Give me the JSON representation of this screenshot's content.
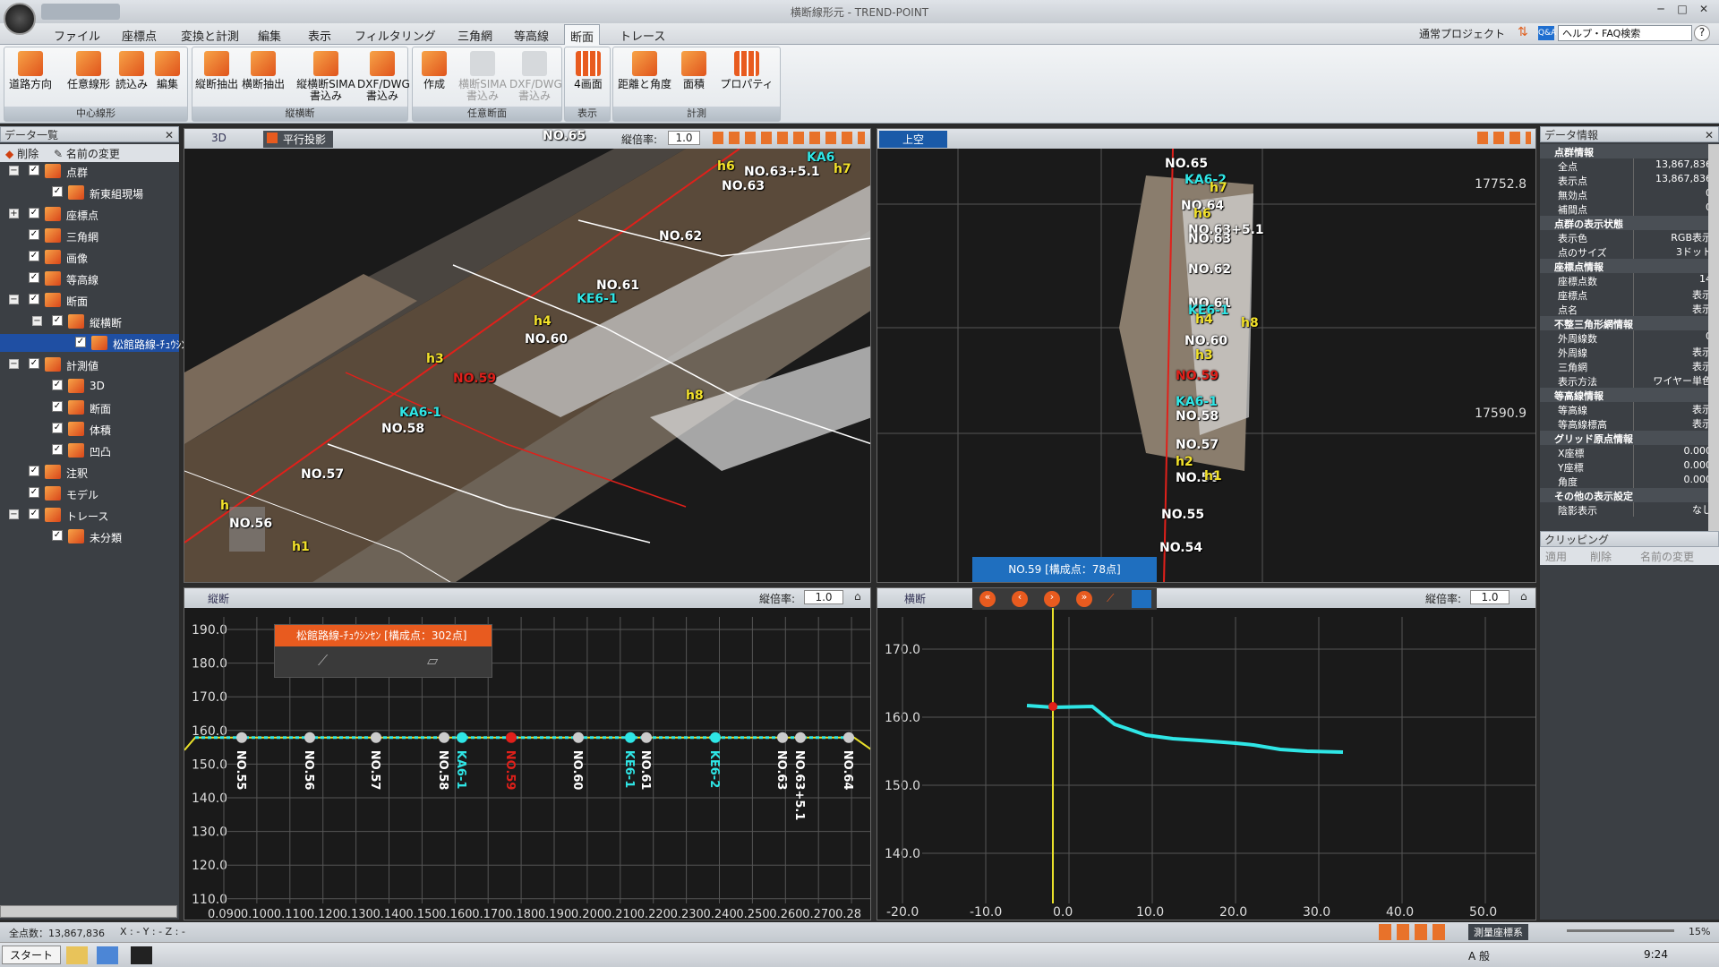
{
  "titlebar": {
    "title": "横断線形元 - TREND-POINT"
  },
  "tabs": [
    "ファイル",
    "座標点",
    "変換と計測",
    "編集",
    "表示",
    "フィルタリング",
    "三角網",
    "等高線",
    "断面",
    "トレース"
  ],
  "active_tab": "断面",
  "topright": {
    "project": "通常プロジェクト",
    "search_placeholder": "ヘルプ・FAQ検索"
  },
  "ribbon": {
    "groups": [
      {
        "label": "中心線形",
        "buttons": [
          "道路方向",
          "任意線形",
          "読込み",
          "編集"
        ]
      },
      {
        "label": "縦横断",
        "buttons": [
          "縦断抽出",
          "横断抽出",
          "縦横断SIMA 書込み",
          "DXF/DWG 書込み"
        ]
      },
      {
        "label": "任意断面",
        "buttons": [
          "作成",
          "横断SIMA 書込み",
          "DXF/DWG 書込み"
        ]
      },
      {
        "label": "表示",
        "buttons": [
          "4画面"
        ]
      },
      {
        "label": "計測",
        "buttons": [
          "距離と角度",
          "面積",
          "プロパティ"
        ]
      }
    ]
  },
  "left_panel": {
    "title": "データ一覧",
    "toolbar": {
      "delete": "削除",
      "rename": "名前の変更"
    },
    "tree": [
      {
        "label": "点群",
        "level": 0,
        "expand": "−"
      },
      {
        "label": "新東組現場",
        "level": 1
      },
      {
        "label": "座標点",
        "level": 0,
        "expand": "+"
      },
      {
        "label": "三角網",
        "level": 0
      },
      {
        "label": "画像",
        "level": 0
      },
      {
        "label": "等高線",
        "level": 0
      },
      {
        "label": "断面",
        "level": 0,
        "expand": "−"
      },
      {
        "label": "縦横断",
        "level": 1,
        "expand": "−"
      },
      {
        "label": "松館路線-ﾁｭｳｼﾝｾﾝ",
        "level": 2,
        "selected": true
      },
      {
        "label": "計測値",
        "level": 0,
        "expand": "−"
      },
      {
        "label": "3D",
        "level": 1
      },
      {
        "label": "断面",
        "level": 1
      },
      {
        "label": "体積",
        "level": 1
      },
      {
        "label": "凹凸",
        "level": 1
      },
      {
        "label": "注釈",
        "level": 0
      },
      {
        "label": "モデル",
        "level": 0
      },
      {
        "label": "トレース",
        "level": 0,
        "expand": "−"
      },
      {
        "label": "未分類",
        "level": 1
      }
    ]
  },
  "view3d": {
    "tab": "3D",
    "mode": "平行投影",
    "scale_label": "縦倍率:",
    "scale": "1.0",
    "labels": [
      {
        "t": "NO.65",
        "c": "w"
      },
      {
        "t": "h6",
        "c": "y"
      },
      {
        "t": "NO.63+5.1",
        "c": "w"
      },
      {
        "t": "KA6",
        "c": "c"
      },
      {
        "t": "h7",
        "c": "y"
      },
      {
        "t": "NO.63",
        "c": "w"
      },
      {
        "t": "NO.62",
        "c": "w"
      },
      {
        "t": "NO.61",
        "c": "w"
      },
      {
        "t": "KE6-1",
        "c": "c"
      },
      {
        "t": "h4",
        "c": "y"
      },
      {
        "t": "NO.60",
        "c": "w"
      },
      {
        "t": "h3",
        "c": "y"
      },
      {
        "t": "NO.59",
        "c": "r"
      },
      {
        "t": "h8",
        "c": "y"
      },
      {
        "t": "KA6-1",
        "c": "c"
      },
      {
        "t": "NO.58",
        "c": "w"
      },
      {
        "t": "NO.57",
        "c": "w"
      },
      {
        "t": "NO.56",
        "c": "w"
      },
      {
        "t": "h1",
        "c": "y"
      },
      {
        "t": "h",
        "c": "y"
      }
    ]
  },
  "viewTop": {
    "tab": "上空",
    "ycoord1": "17752.8",
    "ycoord2": "17590.9",
    "labels": [
      {
        "t": "NO.65",
        "c": "w"
      },
      {
        "t": "KA6-2",
        "c": "c"
      },
      {
        "t": "h7",
        "c": "y"
      },
      {
        "t": "NO.64",
        "c": "w"
      },
      {
        "t": "h6",
        "c": "y"
      },
      {
        "t": "NO.63+5.1",
        "c": "w"
      },
      {
        "t": "NO.63",
        "c": "w"
      },
      {
        "t": "NO.62",
        "c": "w"
      },
      {
        "t": "NO.61",
        "c": "w"
      },
      {
        "t": "KE6-1",
        "c": "c"
      },
      {
        "t": "h4",
        "c": "y"
      },
      {
        "t": "h8",
        "c": "y"
      },
      {
        "t": "NO.60",
        "c": "w"
      },
      {
        "t": "h3",
        "c": "y"
      },
      {
        "t": "NO.59",
        "c": "r"
      },
      {
        "t": "KA6-1",
        "c": "c"
      },
      {
        "t": "NO.58",
        "c": "w"
      },
      {
        "t": "NO.57",
        "c": "w"
      },
      {
        "t": "h2",
        "c": "y"
      },
      {
        "t": "NO.56",
        "c": "w"
      },
      {
        "t": "h1",
        "c": "y"
      },
      {
        "t": "NO.55",
        "c": "w"
      },
      {
        "t": "NO.54",
        "c": "w"
      }
    ]
  },
  "longitudinal": {
    "tab": "縦断",
    "scale_label": "縦倍率:",
    "scale": "1.0",
    "popup": "松館路線-ﾁｭｳｼﾝｾﾝ [構成点：302点]",
    "y_ticks": [
      "190.0",
      "180.0",
      "170.0",
      "160.0",
      "150.0",
      "140.0",
      "130.0",
      "120.0",
      "110.0"
    ],
    "x_ticks": [
      "0.090",
      "0.100",
      "0.110",
      "0.120",
      "0.130",
      "0.140",
      "0.150",
      "0.160",
      "0.170",
      "0.180",
      "0.190",
      "0.200",
      "0.210",
      "0.220",
      "0.230",
      "0.240",
      "0.250",
      "0.260",
      "0.270",
      "0.28"
    ],
    "stations": [
      {
        "t": "NO.55",
        "c": "w"
      },
      {
        "t": "NO.56",
        "c": "w"
      },
      {
        "t": "NO.57",
        "c": "w"
      },
      {
        "t": "NO.58",
        "c": "w"
      },
      {
        "t": "KA6-1",
        "c": "c"
      },
      {
        "t": "NO.59",
        "c": "r"
      },
      {
        "t": "NO.60",
        "c": "w"
      },
      {
        "t": "KE6-1",
        "c": "c"
      },
      {
        "t": "NO.61",
        "c": "w"
      },
      {
        "t": "KE6-2",
        "c": "c"
      },
      {
        "t": "NO.63",
        "c": "w"
      },
      {
        "t": "NO.63+5.1",
        "c": "w"
      },
      {
        "t": "NO.64",
        "c": "w"
      }
    ]
  },
  "cross": {
    "tab": "横断",
    "scale_label": "縦倍率:",
    "scale": "1.0",
    "station_popup": "NO.59 [構成点：78点]",
    "y_ticks": [
      "170.0",
      "160.0",
      "150.0",
      "140.0"
    ],
    "x_ticks": [
      "-20.0",
      "-10.0",
      "0.0",
      "10.0",
      "20.0",
      "30.0",
      "40.0",
      "50.0"
    ]
  },
  "right_panel": {
    "title": "データ情報",
    "rows": [
      {
        "sec": "点群情報"
      },
      {
        "k": "全点",
        "v": "13,867,836"
      },
      {
        "k": "表示点",
        "v": "13,867,836"
      },
      {
        "k": "無効点",
        "v": "0"
      },
      {
        "k": "補間点",
        "v": "0"
      },
      {
        "sec": "点群の表示状態"
      },
      {
        "k": "表示色",
        "v": "RGB表示"
      },
      {
        "k": "点のサイズ",
        "v": "3ドット"
      },
      {
        "sec": "座標点情報"
      },
      {
        "k": "座標点数",
        "v": "14"
      },
      {
        "k": "座標点",
        "v": "表示"
      },
      {
        "k": "点名",
        "v": "表示"
      },
      {
        "sec": "不整三角形網情報"
      },
      {
        "k": "外周線数",
        "v": "0"
      },
      {
        "k": "外周線",
        "v": "表示"
      },
      {
        "k": "三角網",
        "v": "表示"
      },
      {
        "k": "表示方法",
        "v": "ワイヤー単色"
      },
      {
        "sec": "等高線情報"
      },
      {
        "k": "等高線",
        "v": "表示"
      },
      {
        "k": "等高線標高",
        "v": "表示"
      },
      {
        "sec": "グリッド原点情報"
      },
      {
        "k": "X座標",
        "v": "0.000"
      },
      {
        "k": "Y座標",
        "v": "0.000"
      },
      {
        "k": "角度",
        "v": "0.000"
      },
      {
        "sec": "その他の表示設定"
      },
      {
        "k": "陰影表示",
        "v": "なし"
      }
    ],
    "clipping": {
      "title": "クリッピング",
      "apply": "適用",
      "delete": "削除",
      "rename": "名前の変更"
    }
  },
  "status": {
    "total": "全点数：13,867,836",
    "xyz": "X : - Y : - Z : -",
    "coord_system": "測量座標系",
    "zoom": "15%"
  },
  "taskbar": {
    "start": "スタート",
    "time": "9:24",
    "ime": "A 般"
  }
}
